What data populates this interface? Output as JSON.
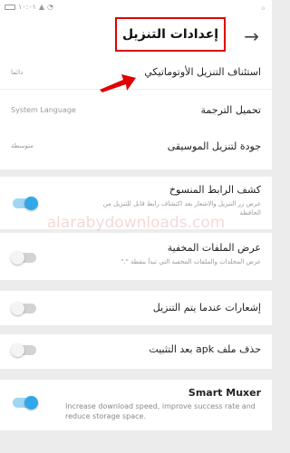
{
  "status": {
    "time": "١٠:٠١",
    "net": "₀"
  },
  "header": {
    "title": "إعدادات التنزيل",
    "back_icon": "arrow-right-icon"
  },
  "settings": {
    "resume": {
      "label": "استئناف التنزيل الأوتوماتيكي",
      "value": "دائما"
    },
    "translation": {
      "label": "تحميل الترجمة",
      "value": "System Language"
    },
    "music": {
      "label": "جودة لتنزيل الموسيقى",
      "value": "متوسطة"
    },
    "copied_link": {
      "label": "كشف الرابط المنسوخ",
      "desc": "عرض زر التنزيل والاشعار بعد اكتشاف رابط قابل للتنزيل من الحافظة",
      "enabled": true
    },
    "hidden_files": {
      "label": "عرض الملفات المخفية",
      "desc": "عرض المجلدات والملفات المخفية التي تبدأ بنقطة \".\"",
      "enabled": false
    },
    "notify": {
      "label": "إشعارات عندما يتم التنزيل",
      "enabled": false
    },
    "delete_apk": {
      "label": "حذف ملف apk بعد التثبيت",
      "enabled": false
    },
    "muxer": {
      "label": "Smart Muxer",
      "desc": "Increase download speed, improve success rate and reduce storage space.",
      "enabled": true
    }
  },
  "watermark": "alarabydownloads.com",
  "colors": {
    "accent": "#32a8e8",
    "highlight": "#e00000"
  }
}
